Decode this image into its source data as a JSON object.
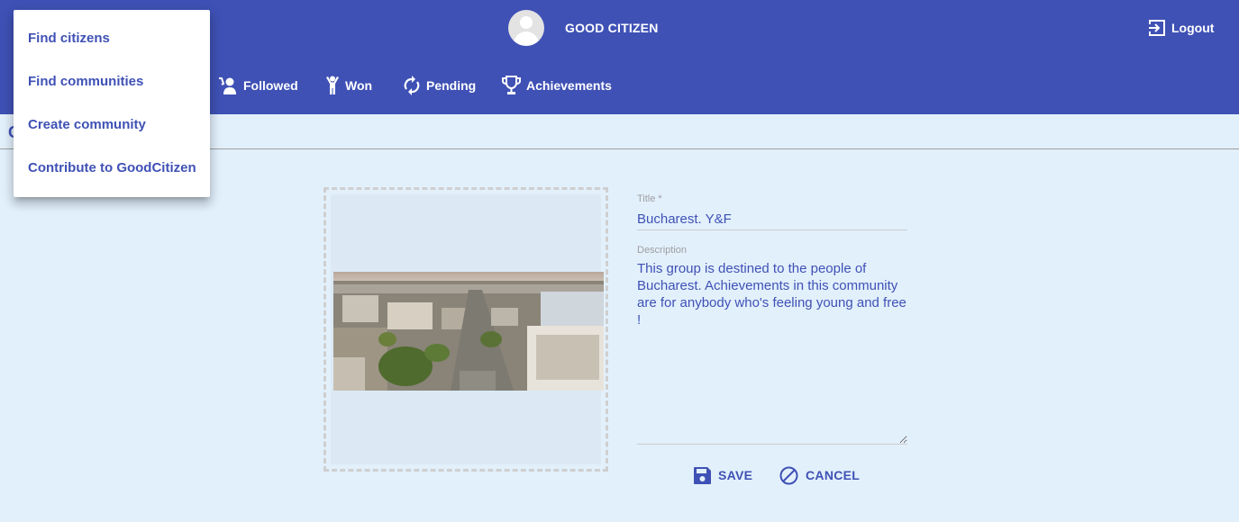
{
  "header": {
    "app_title": "GOOD CITIZEN",
    "logout_label": "Logout",
    "nav": [
      {
        "label": "Followed",
        "icon": "followed-icon"
      },
      {
        "label": "Won",
        "icon": "won-icon"
      },
      {
        "label": "Pending",
        "icon": "pending-icon"
      },
      {
        "label": "Achievements",
        "icon": "trophy-icon"
      }
    ]
  },
  "menu": {
    "items": [
      {
        "label": "Find citizens"
      },
      {
        "label": "Find communities"
      },
      {
        "label": "Create community"
      },
      {
        "label": "Contribute to GoodCitizen"
      }
    ]
  },
  "page": {
    "heading_partial": "C"
  },
  "form": {
    "title_label": "Title *",
    "title_value": "Bucharest. Y&F",
    "description_label": "Description",
    "description_value": "This group is destined to the people of Bucharest. Achievements in this community are for anybody who's feeling young and free !",
    "save_label": "SAVE",
    "cancel_label": "CANCEL"
  },
  "colors": {
    "primary": "#3f51b5",
    "background": "#e2f0fc",
    "menu_bg": "#ffffff"
  }
}
